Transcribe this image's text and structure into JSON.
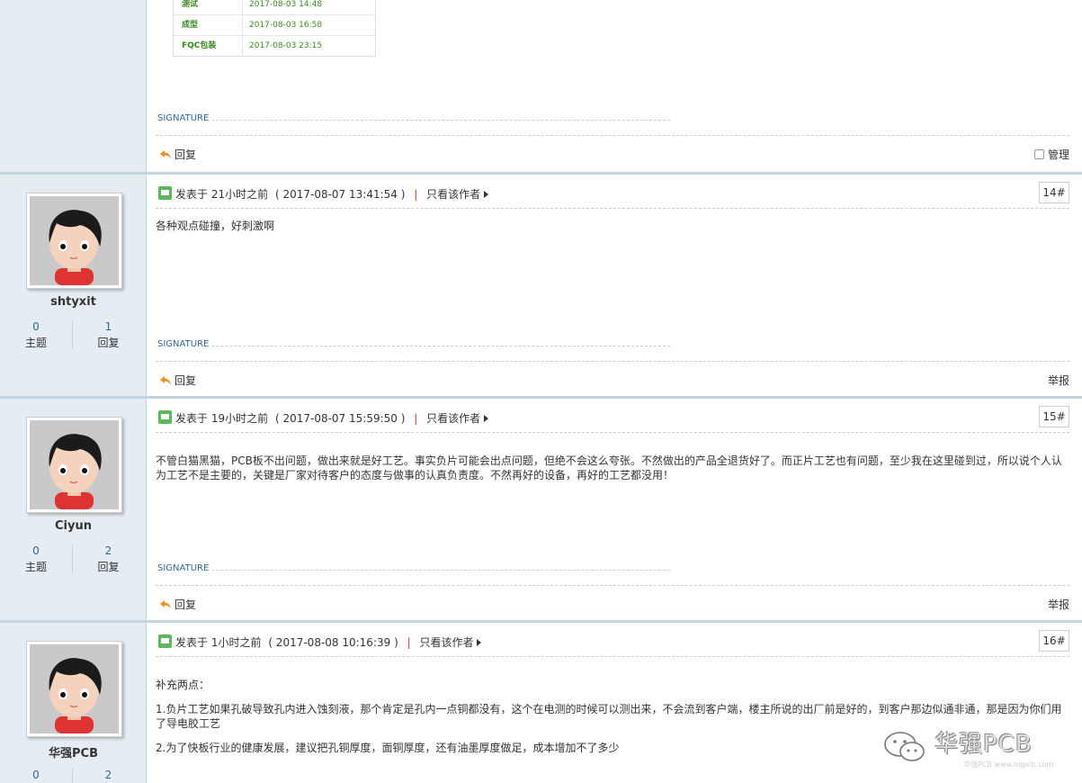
{
  "top_post": {
    "table": [
      {
        "step": "测试",
        "time": "2017-08-03 14:48"
      },
      {
        "step": "成型",
        "time": "2017-08-03 16:58"
      },
      {
        "step": "FQC包装",
        "time": "2017-08-03 23:15"
      }
    ],
    "signature_label": "SIGNATURE",
    "reply_label": "回复",
    "manage_label": "管理"
  },
  "labels": {
    "posted_prefix": "发表于",
    "only_author": "只看该作者",
    "signature": "SIGNATURE",
    "reply": "回复",
    "report": "举报",
    "topics": "主题",
    "replies": "回复"
  },
  "posts": [
    {
      "username": "shtyxit",
      "topics": "0",
      "replies": "1",
      "posted_relative": "21小时之前",
      "posted_time": "( 2017-08-07 13:41:54 )",
      "floor": "14#",
      "paragraphs": [
        "各种观点碰撞，好刺激啊"
      ]
    },
    {
      "username": "Ciyun",
      "topics": "0",
      "replies": "2",
      "posted_relative": "19小时之前",
      "posted_time": "( 2017-08-07 15:59:50 )",
      "floor": "15#",
      "paragraphs": [
        "不管白猫黑猫，PCB板不出问题，做出来就是好工艺。事实负片可能会出点问题，但绝不会这么夸张。不然做出的产品全退货好了。而正片工艺也有问题，至少我在这里碰到过，所以说个人认为工艺不是主要的，关键是厂家对待客户的态度与做事的认真负责度。不然再好的设备，再好的工艺都没用！"
      ]
    },
    {
      "username": "华强PCB",
      "topics": "0",
      "replies": "2",
      "posted_relative": "1小时之前",
      "posted_time": "( 2017-08-08 10:16:39 )",
      "floor": "16#",
      "paragraphs": [
        "补充两点：",
        "1.负片工艺如果孔破导致孔内进入蚀刻液，那个肯定是孔内一点铜都没有，这个在电测的时候可以测出来，不会流到客户端，楼主所说的出厂前是好的，到客户那边似通非通，那是因为你们用了导电胶工艺",
        "2.为了快板行业的健康发展，建议把孔铜厚度，面铜厚度，还有油墨厚度做足，成本增加不了多少"
      ]
    }
  ],
  "watermark": {
    "brand": "华强PCB",
    "sub": "华强PCB  www.hqpcb.com"
  },
  "colors": {
    "sidebar_bg": "#e5edf2",
    "border": "#c2d5e3",
    "link": "#336699",
    "table_text": "#3a8a1e"
  }
}
